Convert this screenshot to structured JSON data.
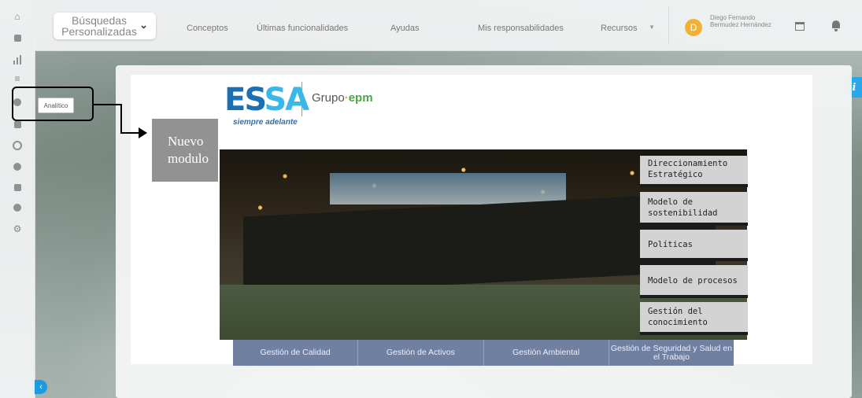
{
  "header": {
    "search_select_label": "Búsquedas Personalizadas",
    "nav": [
      "Conceptos",
      "Últimas funcionalidades",
      "Ayudas",
      "Mis responsabilidades",
      "Recursos"
    ],
    "user_initial": "D",
    "user_name": "Diego Fernando Bermudez Hernández"
  },
  "sidebar": {
    "active_item_label": "Analítico"
  },
  "annotation": {
    "label": "Nuevo modulo"
  },
  "logo": {
    "brand_left": "ES",
    "brand_right": "SA",
    "slogan": "siempre adelante",
    "group": "Grupo",
    "group_dash": "·",
    "group_epm": "epm"
  },
  "side_menu": [
    "Direccionamiento Estratégico",
    "Modelo de sostenibilidad",
    "Políticas",
    "Modelo de procesos",
    "Gestión del conocimiento"
  ],
  "bottom_tabs": [
    "Gestión de Calidad",
    "Gestión de Activos",
    "Gestión Ambiental",
    "Gestión de Seguridad y Salud en el Trabajo"
  ],
  "colors": {
    "accent_blue": "#1e9be0",
    "avatar": "#f2b134",
    "tab_bg": "#7080a0",
    "side_box_bg": "#d3d3d3"
  }
}
